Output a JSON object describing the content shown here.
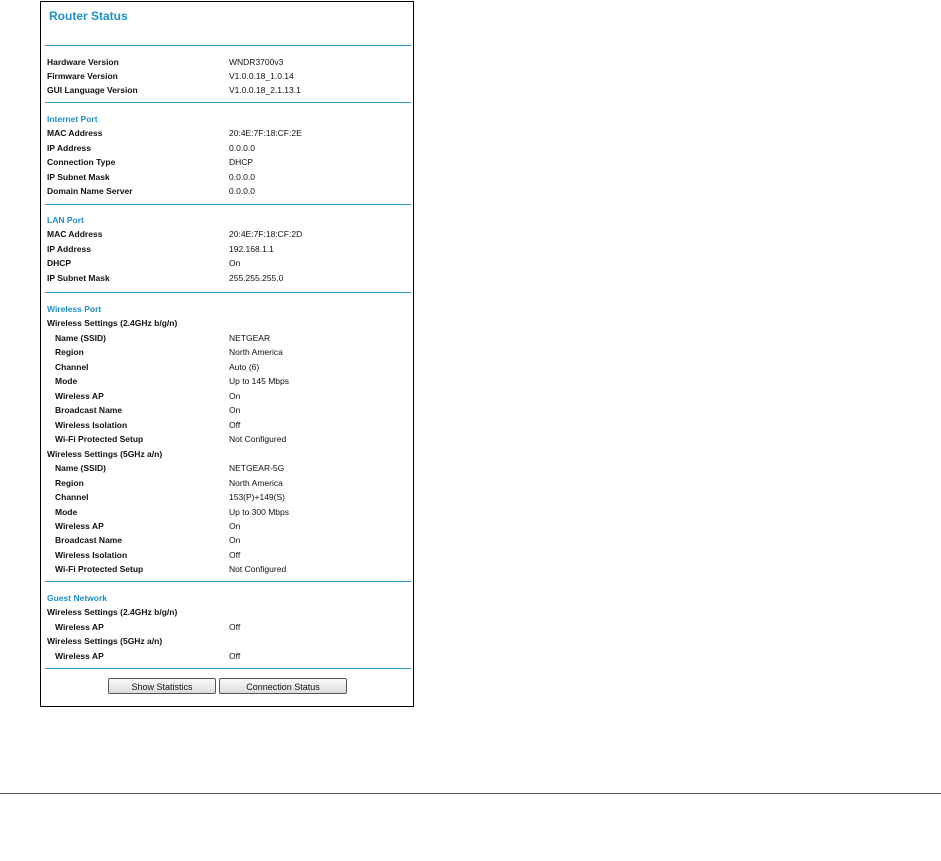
{
  "title": "Router Status",
  "hardware": [
    {
      "label": "Hardware Version",
      "value": "WNDR3700v3"
    },
    {
      "label": "Firmware Version",
      "value": "V1.0.0.18_1.0.14"
    },
    {
      "label": "GUI Language Version",
      "value": "V1.0.0.18_2.1.13.1"
    }
  ],
  "internet_port": {
    "heading": "Internet Port",
    "rows": [
      {
        "label": "MAC Address",
        "value": "20:4E:7F:18:CF:2E"
      },
      {
        "label": "IP Address",
        "value": "0.0.0.0"
      },
      {
        "label": "Connection Type",
        "value": "DHCP"
      },
      {
        "label": "IP Subnet Mask",
        "value": "0.0.0.0"
      },
      {
        "label": "Domain Name Server",
        "value": "0.0.0.0"
      }
    ]
  },
  "lan_port": {
    "heading": "LAN Port",
    "rows": [
      {
        "label": "MAC Address",
        "value": "20:4E:7F:18:CF:2D"
      },
      {
        "label": "IP Address",
        "value": "192.168.1.1"
      },
      {
        "label": "DHCP",
        "value": "On"
      },
      {
        "label": "IP Subnet Mask",
        "value": "255.255.255.0"
      }
    ]
  },
  "wireless_port": {
    "heading": "Wireless Port",
    "band_24": {
      "heading": "Wireless Settings (2.4GHz b/g/n)",
      "rows": [
        {
          "label": "Name (SSID)",
          "value": "NETGEAR"
        },
        {
          "label": "Region",
          "value": "North America"
        },
        {
          "label": "Channel",
          "value": "Auto (6)"
        },
        {
          "label": "Mode",
          "value": "Up to 145 Mbps"
        },
        {
          "label": "Wireless AP",
          "value": "On"
        },
        {
          "label": "Broadcast Name",
          "value": "On"
        },
        {
          "label": "Wireless Isolation",
          "value": "Off"
        },
        {
          "label": "Wi-Fi Protected Setup",
          "value": "Not Configured"
        }
      ]
    },
    "band_5": {
      "heading": "Wireless Settings (5GHz a/n)",
      "rows": [
        {
          "label": "Name (SSID)",
          "value": "NETGEAR-5G"
        },
        {
          "label": "Region",
          "value": "North America"
        },
        {
          "label": "Channel",
          "value": "153(P)+149(S)"
        },
        {
          "label": "Mode",
          "value": "Up to 300 Mbps"
        },
        {
          "label": "Wireless AP",
          "value": "On"
        },
        {
          "label": "Broadcast Name",
          "value": "On"
        },
        {
          "label": "Wireless Isolation",
          "value": "Off"
        },
        {
          "label": "Wi-Fi Protected Setup",
          "value": "Not Configured"
        }
      ]
    }
  },
  "guest_network": {
    "heading": "Guest Network",
    "band_24": {
      "heading": "Wireless Settings (2.4GHz b/g/n)",
      "rows": [
        {
          "label": "Wireless AP",
          "value": "Off"
        }
      ]
    },
    "band_5": {
      "heading": "Wireless Settings (5GHz a/n)",
      "rows": [
        {
          "label": "Wireless AP",
          "value": "Off"
        }
      ]
    }
  },
  "buttons": {
    "show_statistics": "Show Statistics",
    "connection_status": "Connection Status"
  },
  "colors": {
    "accent": "#1e8fc8",
    "rule": "#2f99cc"
  }
}
